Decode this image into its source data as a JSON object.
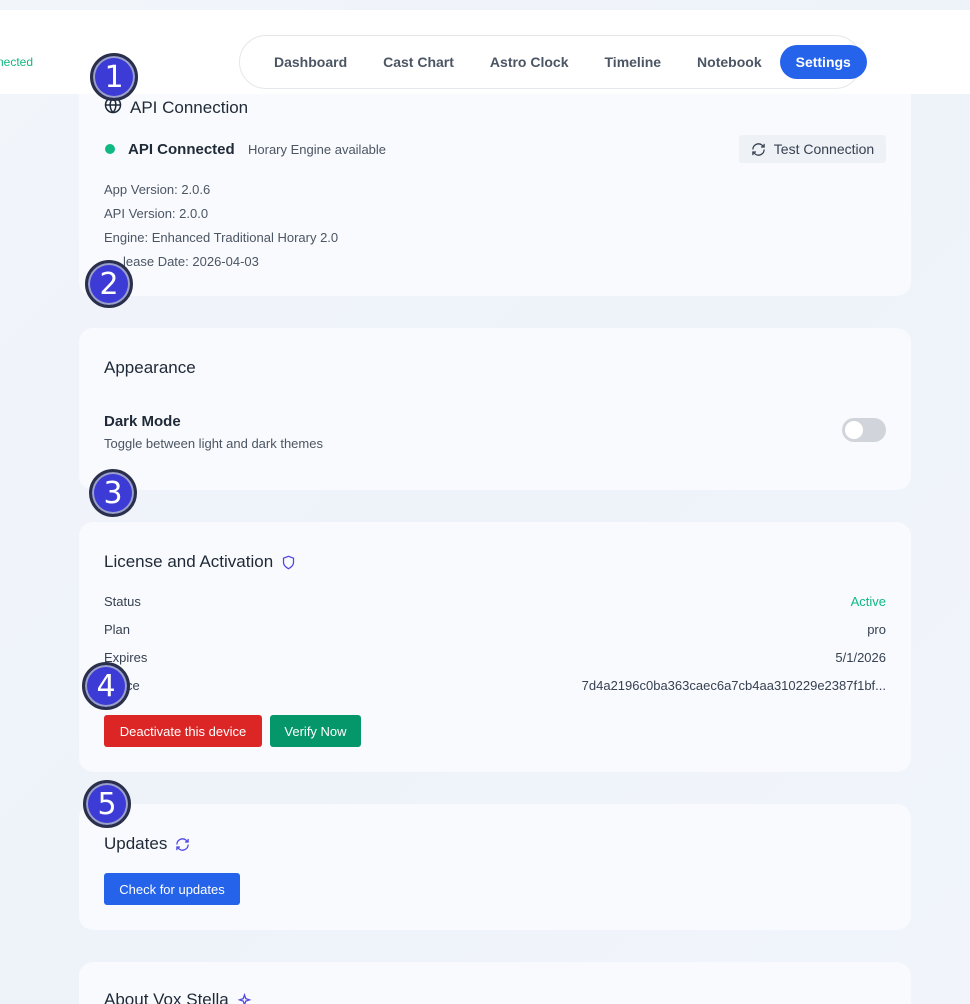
{
  "header": {
    "status_partial": "nected",
    "nav": [
      "Dashboard",
      "Cast Chart",
      "Astro Clock",
      "Timeline",
      "Notebook",
      "Settings"
    ],
    "active": "Settings"
  },
  "api": {
    "title": "API Connection",
    "status": "API Connected",
    "engine_note": "Horary Engine available",
    "test_button": "Test Connection",
    "app_version": "App Version: 2.0.6",
    "api_version": "API Version: 2.0.0",
    "engine": "Engine: Enhanced Traditional Horary 2.0",
    "release_partial": "lease Date: 2026-04-03"
  },
  "appearance": {
    "title": "Appearance",
    "dark_mode_label": "Dark Mode",
    "dark_mode_desc": "Toggle between light and dark themes",
    "dark_mode_on": false
  },
  "license": {
    "title": "License and Activation",
    "status_label": "Status",
    "status_value": "Active",
    "plan_label": "Plan",
    "plan_value": "pro",
    "expires_label": "Expires",
    "expires_value": "5/1/2026",
    "device_label_partial": "ce",
    "device_value": "7d4a2196c0ba363caec6a7cb4aa310229e2387f1bf...",
    "deactivate_button": "Deactivate this device",
    "verify_button": "Verify Now"
  },
  "updates": {
    "title": "Updates",
    "check_button": "Check for updates"
  },
  "about": {
    "title": "About Vox Stella"
  },
  "badges": [
    "1",
    "2",
    "3",
    "4",
    "5"
  ],
  "colors": {
    "accent": "#2563eb",
    "success": "#10b981",
    "danger": "#dc2626",
    "verify": "#059669",
    "badge": "#3d3bd6"
  }
}
